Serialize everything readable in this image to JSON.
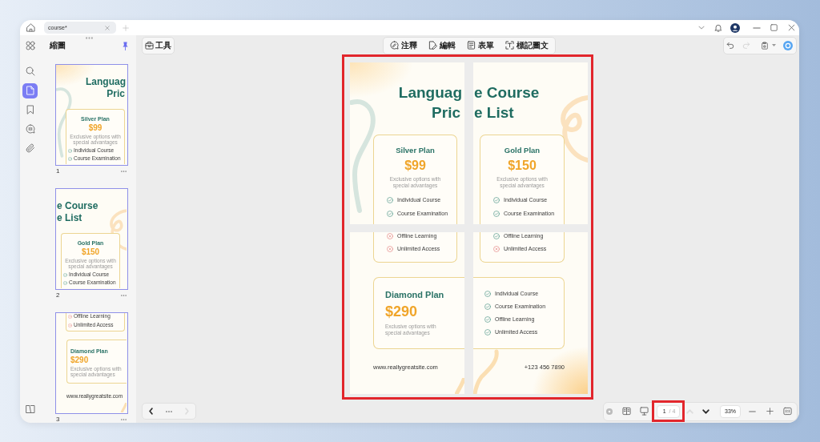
{
  "tabs": [
    {
      "label": "course*",
      "selected": true
    }
  ],
  "sidebar": {
    "rail": [
      {
        "selected": false
      },
      {
        "selected": false
      },
      {
        "selected": true
      },
      {
        "selected": false
      },
      {
        "selected": false
      },
      {
        "selected": false
      }
    ],
    "title": "縮圖",
    "thumbnails": [
      {
        "number": "1",
        "selected": true,
        "page": {
          "title_lines": [
            "Languag",
            "Pric"
          ],
          "plan_card": {
            "name": "Silver Plan",
            "price": "$99",
            "description": "Exclusive options with special advantages",
            "features": [
              {
                "label": "Individual Course",
                "included": true
              },
              {
                "label": "Course Examination",
                "included": true
              }
            ]
          }
        }
      },
      {
        "number": "2",
        "selected": true,
        "page": {
          "title_lines": [
            "e Course",
            "e List"
          ],
          "plan_card": {
            "name": "Gold Plan",
            "price": "$150",
            "description": "Exclusive options with special advantages",
            "features": [
              {
                "label": "Individual Course",
                "included": true
              },
              {
                "label": "Course Examination",
                "included": true
              }
            ]
          }
        }
      },
      {
        "number": "3",
        "selected": true,
        "page": {
          "plan_card_end": {
            "features": [
              {
                "label": "Offline Learning",
                "included": false
              },
              {
                "label": "Unlimited Access",
                "included": false
              }
            ]
          },
          "diamond_card": {
            "name": "Diamond Plan",
            "price": "$290",
            "description": "Exclusive options with special advantages"
          },
          "website": "www.reallygreatsite.com"
        }
      }
    ]
  },
  "toolbar": {
    "tools": "工具",
    "modes": [
      "注釋",
      "編輯",
      "表單",
      "標記圖文"
    ],
    "history": [
      {
        "disabled": false
      },
      {
        "disabled": true
      }
    ]
  },
  "document": {
    "pages": [
      {
        "title_lines": [
          "Languag",
          "Pric"
        ],
        "plan_card": {
          "name": "Silver Plan",
          "price": "$99",
          "description": "Exclusive options with special advantages",
          "features": [
            {
              "label": "Individual Course",
              "included": true
            },
            {
              "label": "Course Examination",
              "included": true
            }
          ]
        }
      },
      {
        "title_lines": [
          "e Course",
          "e List"
        ],
        "plan_card": {
          "name": "Gold Plan",
          "price": "$150",
          "description": "Exclusive options with special advantages",
          "features": [
            {
              "label": "Individual Course",
              "included": true
            },
            {
              "label": "Course Examination",
              "included": true
            }
          ]
        }
      },
      {
        "plan_card_end": {
          "features": [
            {
              "label": "Offline Learning",
              "included": false
            },
            {
              "label": "Unlimited Access",
              "included": false
            }
          ]
        },
        "diamond_card": {
          "name": "Diamond Plan",
          "price": "$290",
          "description": "Exclusive options with special advantages"
        },
        "website": "www.reallygreatsite.com"
      },
      {
        "plan_card_end": {
          "features": [
            {
              "label": "Offline Learning",
              "included": true
            },
            {
              "label": "Unlimited Access",
              "included": false
            }
          ]
        },
        "diamond_card_end": {
          "features": [
            {
              "label": "Individual Course",
              "included": true
            },
            {
              "label": "Course Examination",
              "included": true
            },
            {
              "label": "Offline Learning",
              "included": true
            },
            {
              "label": "Unlimited Access",
              "included": true
            }
          ]
        },
        "phone": "+123 456 7890"
      }
    ]
  },
  "bottom_bar": {
    "view_nav": [
      {
        "disabled": false
      },
      {
        "disabled": true
      }
    ],
    "page_number": "1",
    "page_count": "/ 4",
    "page_steps": [
      {
        "disabled": true
      },
      {
        "disabled": false
      }
    ],
    "zoom": "33%"
  }
}
